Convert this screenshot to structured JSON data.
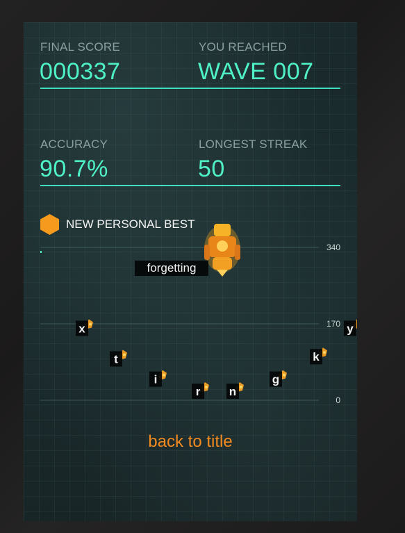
{
  "stats": {
    "final_score_label": "FINAL SCORE",
    "final_score_value": "000337",
    "wave_label": "YOU REACHED",
    "wave_value": "WAVE 007",
    "accuracy_label": "ACCURACY",
    "accuracy_value": "90.7%",
    "streak_label": "LONGEST STREAK",
    "streak_value": "50"
  },
  "personal_best": {
    "label": "NEW PERSONAL BEST",
    "icon": "hexagon-icon",
    "color": "#f59a1c"
  },
  "back_button": {
    "label": "back to title"
  },
  "colors": {
    "accent": "#4ff2c6",
    "orange": "#f28a1f",
    "label": "#8aa0a0"
  },
  "chart_data": {
    "type": "scatter",
    "title": "",
    "ylim": [
      0,
      340
    ],
    "ytick_labels": [
      "340",
      "170",
      "0"
    ],
    "ytick_values": [
      340,
      170,
      0
    ],
    "points": [
      {
        "label": "forgetting",
        "y": 300,
        "boss": true
      },
      {
        "label": "x",
        "y": 160
      },
      {
        "label": "t",
        "y": 92
      },
      {
        "label": "i",
        "y": 47
      },
      {
        "label": "r",
        "y": 20
      },
      {
        "label": "n",
        "y": 20
      },
      {
        "label": "g",
        "y": 47
      },
      {
        "label": "k",
        "y": 97
      },
      {
        "label": "y",
        "y": 160
      }
    ]
  }
}
